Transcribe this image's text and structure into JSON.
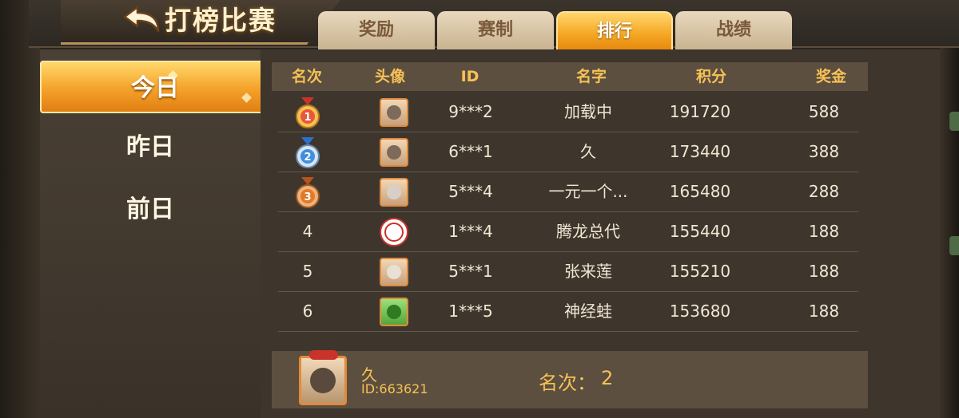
{
  "header": {
    "title": "打榜比赛",
    "tabs": [
      {
        "label": "奖励",
        "active": false
      },
      {
        "label": "赛制",
        "active": false
      },
      {
        "label": "排行",
        "active": true
      },
      {
        "label": "战绩",
        "active": false
      }
    ]
  },
  "sidebar": {
    "items": [
      {
        "label": "今日",
        "active": true
      },
      {
        "label": "昨日",
        "active": false
      },
      {
        "label": "前日",
        "active": false
      }
    ]
  },
  "table": {
    "columns": [
      "名次",
      "头像",
      "ID",
      "名字",
      "积分",
      "奖金"
    ],
    "rows": [
      {
        "rank": "1",
        "medal": "gold",
        "avatar": "photo",
        "id": "9***2",
        "name": "加载中",
        "score": "191720",
        "prize": "588"
      },
      {
        "rank": "2",
        "medal": "silver",
        "avatar": "photo",
        "id": "6***1",
        "name": "久",
        "score": "173440",
        "prize": "388"
      },
      {
        "rank": "3",
        "medal": "bronze",
        "avatar": "default",
        "id": "5***4",
        "name": "一元一个...",
        "score": "165480",
        "prize": "288"
      },
      {
        "rank": "4",
        "medal": "",
        "avatar": "badge",
        "id": "1***4",
        "name": "腾龙总代",
        "score": "155440",
        "prize": "188"
      },
      {
        "rank": "5",
        "medal": "",
        "avatar": "photo",
        "id": "5***1",
        "name": "张来莲",
        "score": "155210",
        "prize": "188"
      },
      {
        "rank": "6",
        "medal": "",
        "avatar": "frog",
        "id": "1***5",
        "name": "神经蛙",
        "score": "153680",
        "prize": "188"
      }
    ]
  },
  "self": {
    "name": "久",
    "id_text": "ID:663621",
    "rank_label": "名次：",
    "rank_value": "2"
  },
  "colors": {
    "accent": "#f5a623",
    "header_text": "#f7c255",
    "body_text": "#f1e6d2",
    "medal_gold": "#e8573b",
    "medal_silver": "#3f8fe0",
    "medal_bronze": "#e07a2a"
  }
}
